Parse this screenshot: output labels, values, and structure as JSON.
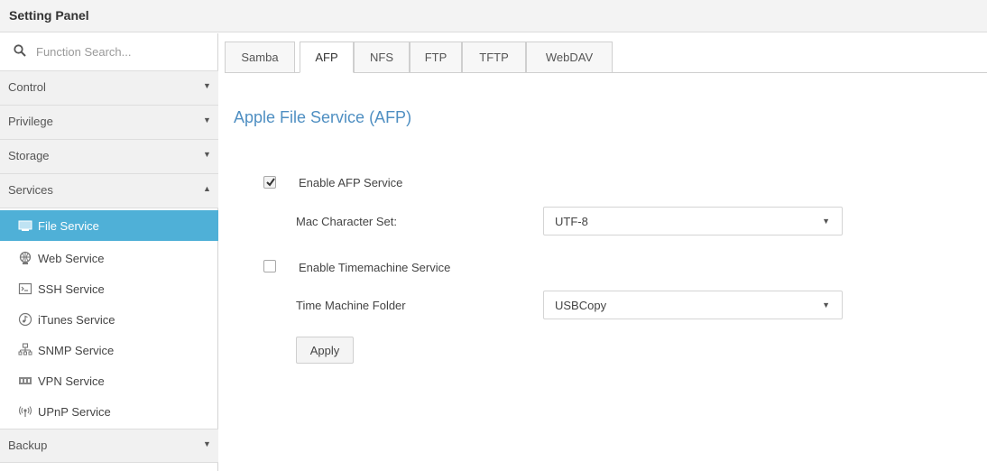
{
  "app": {
    "title": "Setting Panel"
  },
  "search": {
    "placeholder": "Function Search..."
  },
  "sidebar": {
    "categories": [
      {
        "label": "Control",
        "arrow": "▼"
      },
      {
        "label": "Privilege",
        "arrow": "▼"
      },
      {
        "label": "Storage",
        "arrow": "▼"
      },
      {
        "label": "Services",
        "arrow": "▲"
      },
      {
        "label": "Backup",
        "arrow": "▼"
      }
    ],
    "services": [
      {
        "label": "File Service",
        "icon": "file-service-icon",
        "active": true
      },
      {
        "label": "Web Service",
        "icon": "web-service-icon"
      },
      {
        "label": "SSH Service",
        "icon": "ssh-service-icon"
      },
      {
        "label": "iTunes Service",
        "icon": "itunes-service-icon"
      },
      {
        "label": "SNMP Service",
        "icon": "snmp-service-icon"
      },
      {
        "label": "VPN Service",
        "icon": "vpn-service-icon"
      },
      {
        "label": "UPnP Service",
        "icon": "upnp-service-icon"
      }
    ]
  },
  "tabs": [
    {
      "label": "Samba"
    },
    {
      "label": "AFP",
      "active": true
    },
    {
      "label": "NFS"
    },
    {
      "label": "FTP"
    },
    {
      "label": "TFTP"
    },
    {
      "label": "WebDAV"
    }
  ],
  "afp": {
    "title": "Apple File Service (AFP)",
    "enable_afp": {
      "label": "Enable AFP Service",
      "checked": true
    },
    "charset": {
      "label": "Mac Character Set:",
      "value": "UTF-8"
    },
    "enable_timemachine": {
      "label": "Enable Timemachine Service",
      "checked": false
    },
    "tm_folder": {
      "label": "Time Machine Folder",
      "value": "USBCopy"
    },
    "apply_label": "Apply"
  },
  "colors": {
    "accent": "#4fb0d7",
    "title_blue": "#4f8fc2"
  }
}
